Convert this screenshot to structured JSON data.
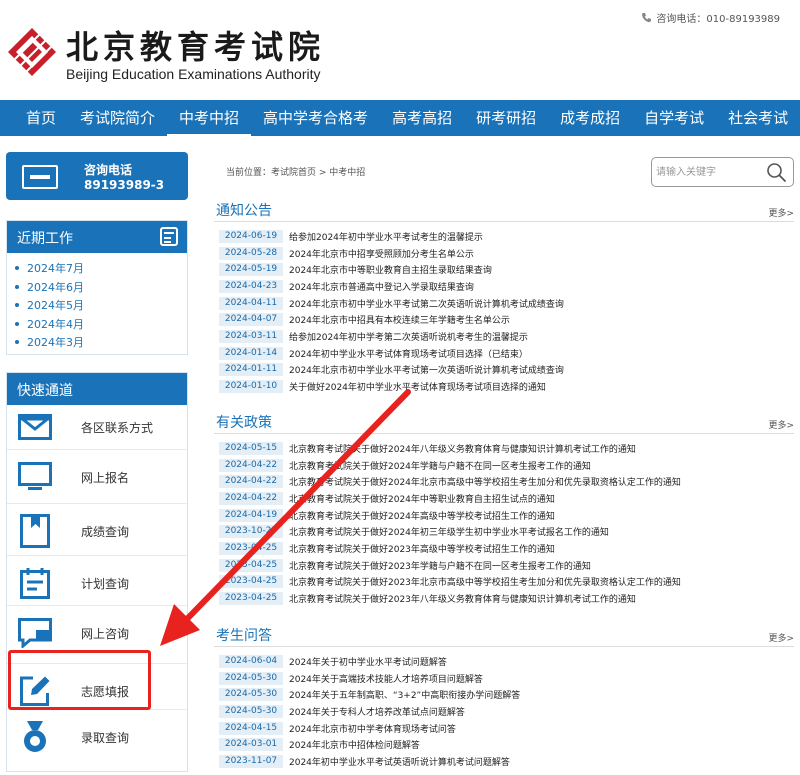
{
  "header": {
    "logo_cn": "北京教育考试院",
    "logo_en": "Beijing Education Examinations Authority",
    "phone_text": "咨询电话：010-89193989"
  },
  "nav": {
    "items": [
      "首页",
      "考试院简介",
      "中考中招",
      "高中学考合格考",
      "高考高招",
      "研考研招",
      "成考成招",
      "自学考试",
      "社会考试"
    ],
    "active_index": 2
  },
  "hotline": {
    "label": "咨询电话",
    "number": "89193989-3"
  },
  "recent": {
    "title": "近期工作",
    "items": [
      "2024年7月",
      "2024年6月",
      "2024年5月",
      "2024年4月",
      "2024年3月"
    ]
  },
  "quick": {
    "title": "快速通道",
    "items": [
      {
        "label": "各区联系方式",
        "icon": "envelope-icon"
      },
      {
        "label": "网上报名",
        "icon": "monitor-icon"
      },
      {
        "label": "成绩查询",
        "icon": "bookmark-icon"
      },
      {
        "label": "计划查询",
        "icon": "calendar-icon"
      },
      {
        "label": "网上咨询",
        "icon": "chat-icon"
      },
      {
        "label": "志愿填报",
        "icon": "edit-icon"
      },
      {
        "label": "录取查询",
        "icon": "medal-icon"
      }
    ]
  },
  "breadcrumb": "当前位置：考试院首页 > 中考中招",
  "search": {
    "placeholder": "请输入关键字"
  },
  "sections": [
    {
      "title": "通知公告",
      "more": "更多>",
      "items": [
        {
          "date": "2024-06-19",
          "text": "给参加2024年初中学业水平考试考生的温馨提示"
        },
        {
          "date": "2024-05-28",
          "text": "2024年北京市中招享受照顾加分考生名单公示"
        },
        {
          "date": "2024-05-19",
          "text": "2024年北京市中等职业教育自主招生录取结果查询"
        },
        {
          "date": "2024-04-23",
          "text": "2024年北京市普通高中登记入学录取结果查询"
        },
        {
          "date": "2024-04-11",
          "text": "2024年北京市初中学业水平考试第二次英语听说计算机考试成绩查询"
        },
        {
          "date": "2024-04-07",
          "text": "2024年北京市中招具有本校连续三年学籍考生名单公示"
        },
        {
          "date": "2024-03-11",
          "text": "给参加2024年初中学考第二次英语听说机考考生的温馨提示"
        },
        {
          "date": "2024-01-14",
          "text": "2024年初中学业水平考试体育现场考试项目选择（已结束）"
        },
        {
          "date": "2024-01-11",
          "text": "2024年北京市初中学业水平考试第一次英语听说计算机考试成绩查询"
        },
        {
          "date": "2024-01-10",
          "text": "关于做好2024年初中学业水平考试体育现场考试项目选择的通知"
        }
      ]
    },
    {
      "title": "有关政策",
      "more": "更多>",
      "items": [
        {
          "date": "2024-05-15",
          "text": "北京教育考试院关于做好2024年八年级义务教育体育与健康知识计算机考试工作的通知"
        },
        {
          "date": "2024-04-22",
          "text": "北京教育考试院关于做好2024年学籍与户籍不在同一区考生报考工作的通知"
        },
        {
          "date": "2024-04-22",
          "text": "北京教育考试院关于做好2024年北京市高级中等学校招生考生加分和优先录取资格认定工作的通知"
        },
        {
          "date": "2024-04-22",
          "text": "北京教育考试院关于做好2024年中等职业教育自主招生试点的通知"
        },
        {
          "date": "2024-04-19",
          "text": "北京教育考试院关于做好2024年高级中等学校考试招生工作的通知"
        },
        {
          "date": "2023-10-25",
          "text": "北京教育考试院关于做好2024年初三年级学生初中学业水平考试报名工作的通知"
        },
        {
          "date": "2023-04-25",
          "text": "北京教育考试院关于做好2023年高级中等学校考试招生工作的通知"
        },
        {
          "date": "2023-04-25",
          "text": "北京教育考试院关于做好2023年学籍与户籍不在同一区考生报考工作的通知"
        },
        {
          "date": "2023-04-25",
          "text": "北京教育考试院关于做好2023年北京市高级中等学校招生考生加分和优先录取资格认定工作的通知"
        },
        {
          "date": "2023-04-25",
          "text": "北京教育考试院关于做好2023年八年级义务教育体育与健康知识计算机考试工作的通知"
        }
      ]
    },
    {
      "title": "考生问答",
      "more": "更多>",
      "items": [
        {
          "date": "2024-06-04",
          "text": "2024年关于初中学业水平考试问题解答"
        },
        {
          "date": "2024-05-30",
          "text": "2024年关于高端技术技能人才培养项目问题解答"
        },
        {
          "date": "2024-05-30",
          "text": "2024年关于五年制高职、“3+2”中高职衔接办学问题解答"
        },
        {
          "date": "2024-05-30",
          "text": "2024年关于专科人才培养改革试点问题解答"
        },
        {
          "date": "2024-04-15",
          "text": "2024年北京市初中学考体育现场考试问答"
        },
        {
          "date": "2024-03-01",
          "text": "2024年北京市中招体检问题解答"
        },
        {
          "date": "2023-11-07",
          "text": "2024年初中学业水平考试英语听说计算机考试问题解答"
        }
      ]
    }
  ],
  "colors": {
    "brand_blue": "#1a73b8",
    "date_bg": "#e4eef7",
    "highlight_red": "#e8231f",
    "logo_red": "#c8202a"
  }
}
